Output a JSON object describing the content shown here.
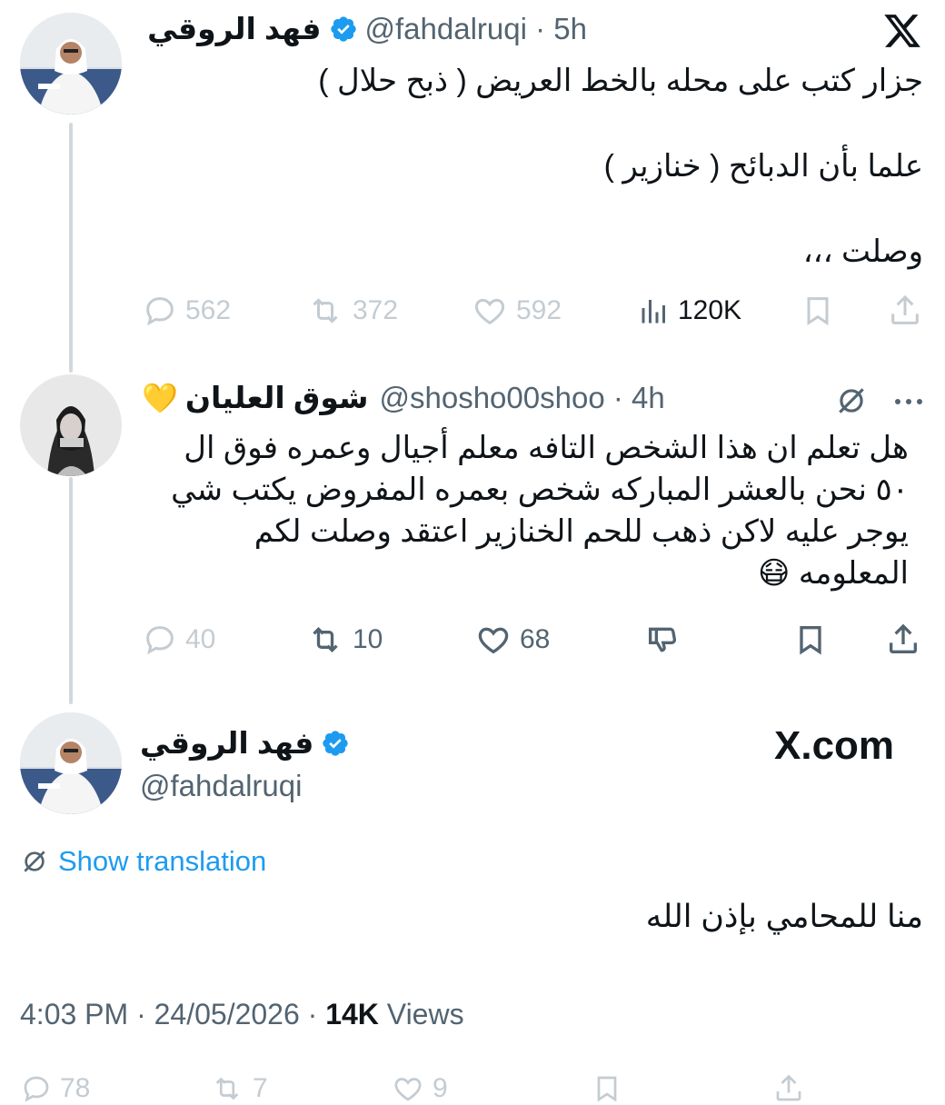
{
  "tweet1": {
    "name": "فهد الروقي",
    "handle": "@fahdalruqi",
    "time": "5h",
    "text_lines": [
      "جزار كتب على محله بالخط العريض ( ذبح حلال )",
      "علما بأن الدبائح ( خنازير )",
      "وصلت ،،،"
    ],
    "actions": {
      "replies": "562",
      "reposts": "372",
      "likes": "592",
      "views": "120K"
    }
  },
  "tweet2": {
    "name": "شوق العليان",
    "name_emoji": "💛",
    "handle": "@shosho00shoo",
    "time": "4h",
    "text_lines": [
      "هل تعلم ان هذا الشخص التافه معلم أجيال وعمره فوق ال",
      "٥٠ نحن بالعشر المباركه شخص بعمره المفروض يكتب شي",
      "يوجر عليه لاكن ذهب للحم الخنازير اعتقد وصلت لكم",
      "المعلومه 😷"
    ],
    "actions": {
      "replies": "40",
      "reposts": "10",
      "likes": "68"
    }
  },
  "tweet3": {
    "name": "فهد الروقي",
    "handle": "@fahdalruqi",
    "brand": "X.com",
    "show_translation": "Show translation",
    "text": "منا للمحامي بإذن الله",
    "timestamp": "4:03 PM · 24/05/2026 · ",
    "views_count": "14K",
    "views_label": " Views",
    "bottom_actions": {
      "replies": "78",
      "reposts": "7",
      "likes": "9"
    }
  },
  "colors": {
    "accent": "#1d9bf0",
    "text": "#0f1419",
    "secondary": "#536471",
    "faded": "#c4ccd2",
    "thread": "#cfd9de"
  },
  "icons": {
    "x_logo": "x-logo-icon",
    "verified": "verified-badge-icon",
    "reply": "reply-icon",
    "repost": "repost-icon",
    "like": "heart-icon",
    "views": "views-chart-icon",
    "bookmark": "bookmark-icon",
    "share": "share-icon",
    "translate": "translate-icon",
    "more": "more-icon",
    "dislike": "dislike-icon"
  }
}
